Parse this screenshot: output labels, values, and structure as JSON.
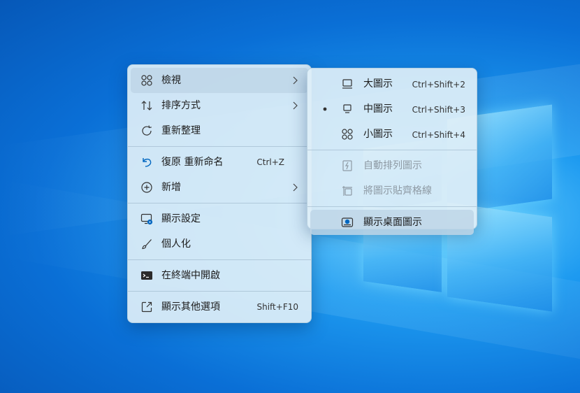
{
  "menu": {
    "items": [
      {
        "label": "檢視"
      },
      {
        "label": "排序方式"
      },
      {
        "label": "重新整理"
      },
      {
        "label": "復原 重新命名",
        "shortcut": "Ctrl+Z"
      },
      {
        "label": "新增"
      },
      {
        "label": "顯示設定"
      },
      {
        "label": "個人化"
      },
      {
        "label": "在終端中開啟"
      },
      {
        "label": "顯示其他選項",
        "shortcut": "Shift+F10"
      }
    ]
  },
  "submenu": {
    "items": [
      {
        "label": "大圖示",
        "shortcut": "Ctrl+Shift+2"
      },
      {
        "label": "中圖示",
        "shortcut": "Ctrl+Shift+3",
        "selected": true
      },
      {
        "label": "小圖示",
        "shortcut": "Ctrl+Shift+4"
      },
      {
        "label": "自動排列圖示",
        "enabled": false
      },
      {
        "label": "將圖示貼齊格線",
        "enabled": false
      },
      {
        "label": "顯示桌面圖示",
        "checked": true
      }
    ]
  },
  "colors": {
    "accent": "#0067c0",
    "menu_background": "#deeef8",
    "wallpaper": "#0a6fd6"
  }
}
